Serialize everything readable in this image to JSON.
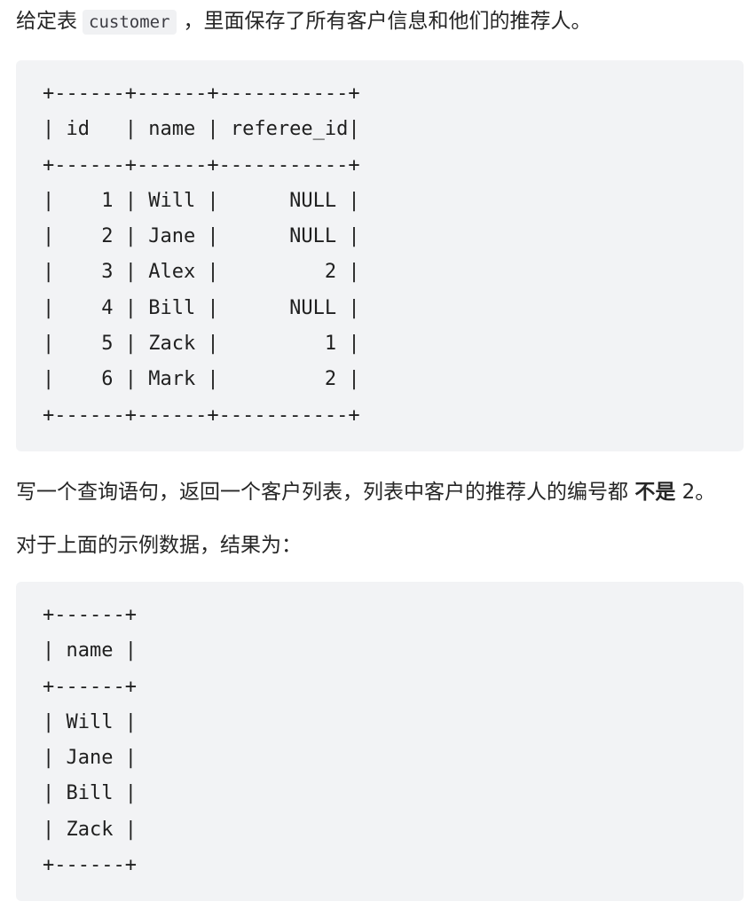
{
  "intro": {
    "prefix": "给定表",
    "table_name": "customer",
    "suffix": "，里面保存了所有客户信息和他们的推荐人。"
  },
  "input_table": {
    "lines": [
      "+------+------+-----------+",
      "| id   | name | referee_id|",
      "+------+------+-----------+",
      "|    1 | Will |      NULL |",
      "|    2 | Jane |      NULL |",
      "|    3 | Alex |         2 |",
      "|    4 | Bill |      NULL |",
      "|    5 | Zack |         1 |",
      "|    6 | Mark |         2 |",
      "+------+------+-----------+"
    ]
  },
  "task": {
    "text_before": "写一个查询语句，返回一个客户列表，列表中客户的推荐人的编号都 ",
    "emphasis": "不是",
    "text_after": " 2。"
  },
  "result_intro": "对于上面的示例数据，结果为：",
  "result_table": {
    "lines": [
      "+------+",
      "| name |",
      "+------+",
      "| Will |",
      "| Jane |",
      "| Bill |",
      "| Zack |",
      "+------+"
    ]
  }
}
